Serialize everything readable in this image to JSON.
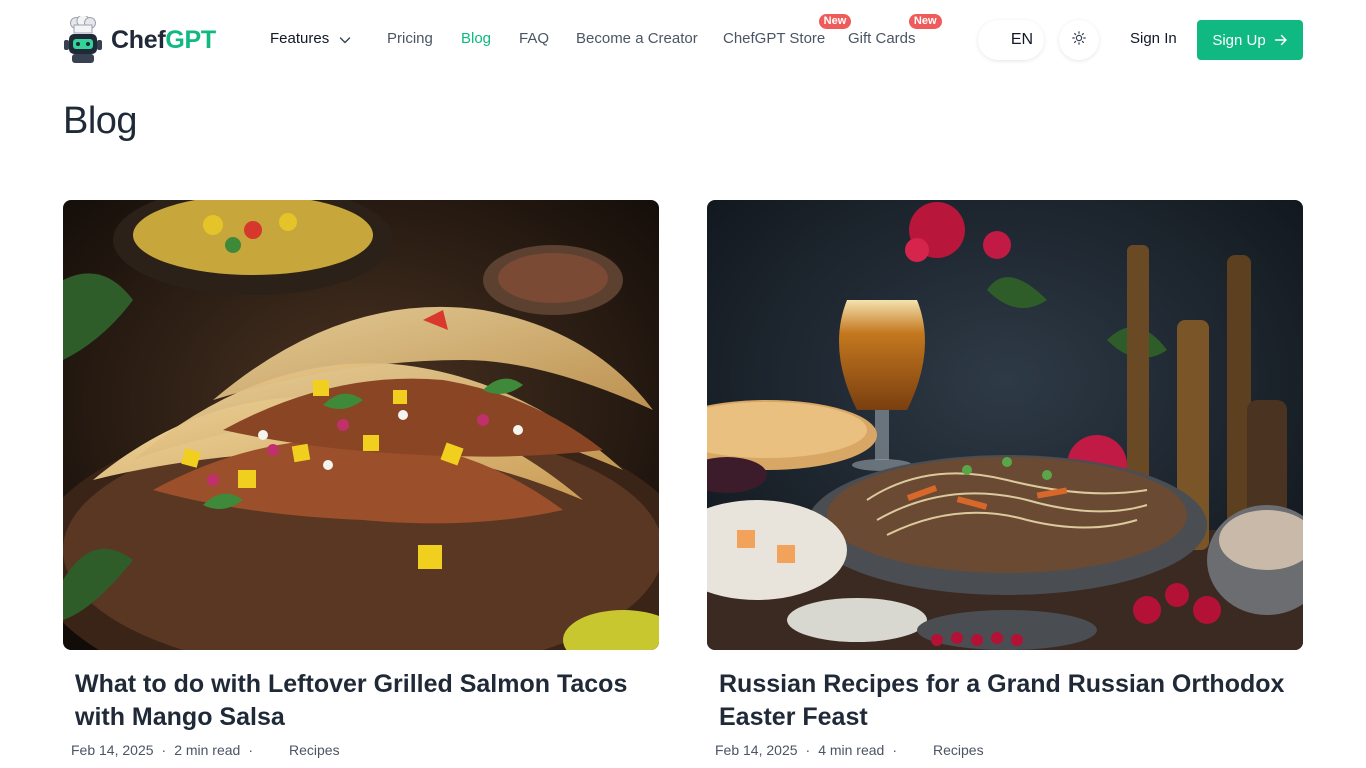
{
  "brand": {
    "name_part1": "Chef",
    "name_part2": "GPT",
    "accent": "#10b981"
  },
  "nav": {
    "features": "Features",
    "pricing": "Pricing",
    "blog": "Blog",
    "faq": "FAQ",
    "creator": "Become a Creator",
    "store": "ChefGPT Store",
    "store_badge": "New",
    "gift": "Gift Cards",
    "gift_badge": "New"
  },
  "header_actions": {
    "language": "EN",
    "theme_icon": "sun-icon",
    "sign_in": "Sign In",
    "sign_up": "Sign Up"
  },
  "page": {
    "title": "Blog"
  },
  "posts": [
    {
      "title": "What to do with Leftover Grilled Salmon Tacos with Mango Salsa",
      "date": "Feb 14, 2025",
      "read_time": "2 min read",
      "category": "Recipes",
      "image": "salmon-tacos-photo"
    },
    {
      "title": "Russian Recipes for a Grand Russian Orthodox Easter Feast",
      "date": "Feb 14, 2025",
      "read_time": "4 min read",
      "category": "Recipes",
      "image": "easter-feast-photo"
    }
  ],
  "separators": {
    "dot": "·"
  }
}
